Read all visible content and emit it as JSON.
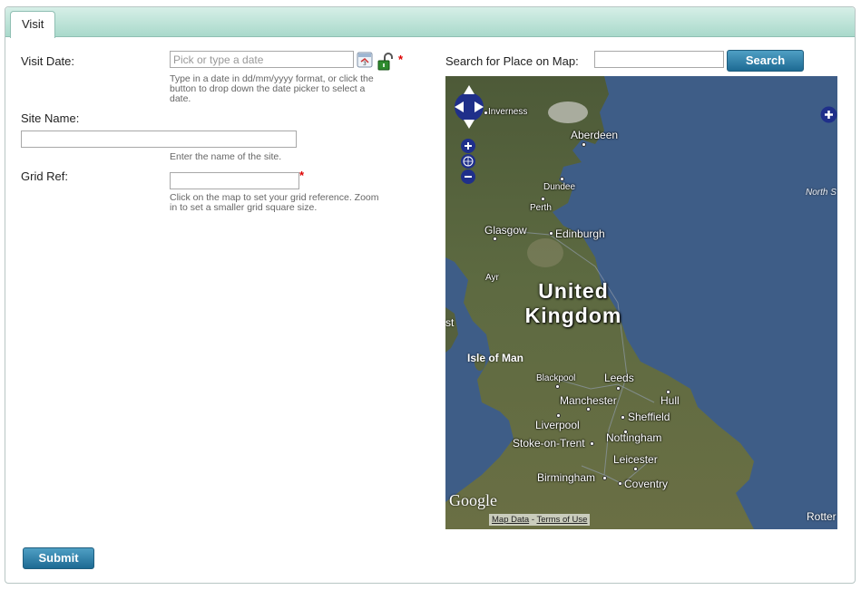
{
  "tabs": [
    {
      "label": "Visit"
    }
  ],
  "form": {
    "visit_date": {
      "label": "Visit Date:",
      "placeholder": "Pick or type a date",
      "help": [
        "Type in a date in dd/mm/yyyy format, or click the",
        "button to drop down the date picker to select a",
        "date."
      ],
      "required": "*"
    },
    "site_name": {
      "label": "Site Name:",
      "help": "Enter the name of the site."
    },
    "grid_ref": {
      "label": "Grid Ref:",
      "help": [
        "Click on the map to set your grid reference. Zoom",
        "in to set a smaller grid square size."
      ],
      "required": "*"
    },
    "search": {
      "label": "Search for Place on Map:",
      "button": "Search"
    },
    "submit": "Submit"
  },
  "map": {
    "country_label": [
      "United",
      "Kingdom"
    ],
    "island_label": "Isle of Man",
    "sea_label": "North S",
    "edge_labels": {
      "right_bottom": "Rotter",
      "left_mid": "st"
    },
    "cities": [
      {
        "name": "Inverness",
        "small": true
      },
      {
        "name": "Aberdeen"
      },
      {
        "name": "Dundee",
        "small": true
      },
      {
        "name": "Perth",
        "small": true
      },
      {
        "name": "Glasgow"
      },
      {
        "name": "Edinburgh"
      },
      {
        "name": "Ayr",
        "small": true
      },
      {
        "name": "Blackpool",
        "small": true
      },
      {
        "name": "Leeds"
      },
      {
        "name": "Manchester"
      },
      {
        "name": "Hull"
      },
      {
        "name": "Liverpool"
      },
      {
        "name": "Sheffield"
      },
      {
        "name": "Nottingham"
      },
      {
        "name": "Stoke-on-Trent"
      },
      {
        "name": "Leicester"
      },
      {
        "name": "Birmingham"
      },
      {
        "name": "Coventry"
      }
    ],
    "attribution": {
      "brand": "Google",
      "map_data": "Map Data",
      "separator": " - ",
      "terms": "Terms of Use"
    }
  }
}
